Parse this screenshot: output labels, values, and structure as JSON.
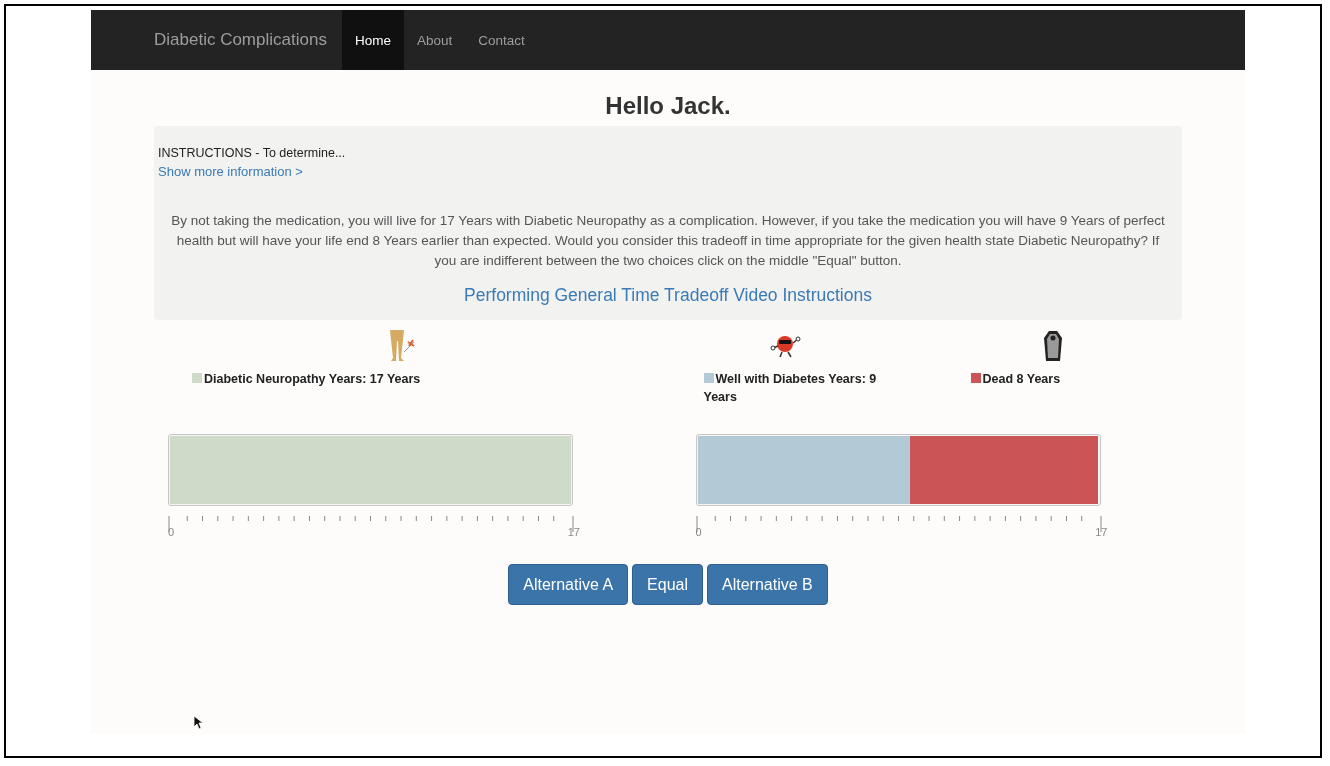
{
  "navbar": {
    "brand": "Diabetic Complications",
    "links": [
      {
        "label": "Home",
        "selected": true
      },
      {
        "label": "About",
        "selected": false
      },
      {
        "label": "Contact",
        "selected": false
      }
    ]
  },
  "greeting": "Hello Jack.",
  "instructions": {
    "heading": "INSTRUCTIONS - To determine...",
    "more_link": "Show more information >",
    "text": "By not taking the medication, you will live for 17 Years with Diabetic Neuropathy as a complication. However, if you take the medication you will have 9 Years of perfect health but will have your life end 8 Years earlier than expected. Would you consider this tradeoff in time appropriate for the given health state Diabetic Neuropathy? If you are indifferent between the two choices click on the middle \"Equal\" button.",
    "video_link": "Performing General Time Tradeoff Video Instructions"
  },
  "timelines": [
    {
      "segments": [
        {
          "kind": "neuropathy",
          "label": "Diabetic Neuropathy Years: 17 Years",
          "color": "#cddbc8",
          "level": 1
        }
      ],
      "axis": {
        "start": "0",
        "end": "17"
      }
    },
    {
      "segments": [
        {
          "kind": "well",
          "label": "Well with Diabetes Years: 9 Years",
          "color": "#b3c9d6",
          "level": 0.529
        },
        {
          "kind": "dead",
          "label": "Dead 8 Years",
          "color": "#cb5456",
          "level": 0.471
        }
      ],
      "axis": {
        "start": "0",
        "end": "17"
      }
    }
  ],
  "buttons": [
    "Alternative A",
    "Equal",
    "Alternative B"
  ]
}
